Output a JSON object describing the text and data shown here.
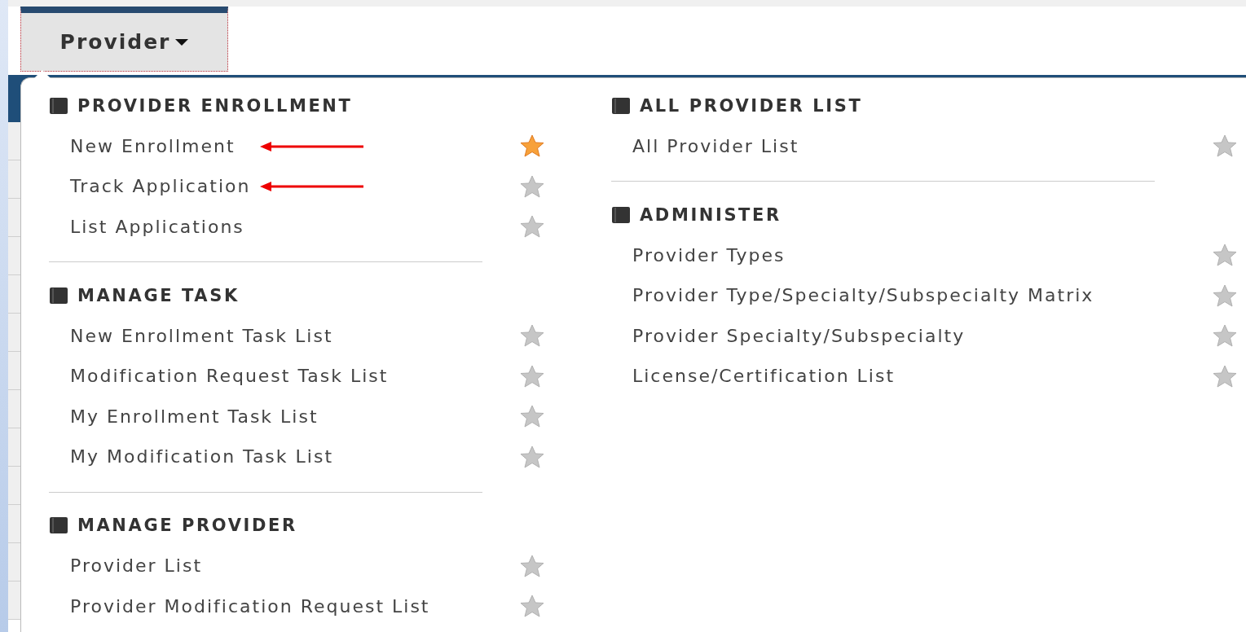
{
  "nav": {
    "tab": {
      "label": "Provider",
      "expanded": true
    }
  },
  "menu": {
    "columns": [
      {
        "sections": [
          {
            "title": "PROVIDER ENROLLMENT",
            "items": [
              {
                "label": "New Enrollment",
                "favorite": true,
                "arrow": true
              },
              {
                "label": "Track Application",
                "favorite": false,
                "arrow": true
              },
              {
                "label": "List Applications",
                "favorite": false,
                "arrow": false
              }
            ]
          },
          {
            "title": "MANAGE TASK",
            "items": [
              {
                "label": "New Enrollment Task List",
                "favorite": false,
                "arrow": false
              },
              {
                "label": "Modification Request Task List",
                "favorite": false,
                "arrow": false
              },
              {
                "label": "My Enrollment Task List",
                "favorite": false,
                "arrow": false
              },
              {
                "label": "My Modification Task List",
                "favorite": false,
                "arrow": false
              }
            ]
          },
          {
            "title": "MANAGE PROVIDER",
            "items": [
              {
                "label": "Provider List",
                "favorite": false,
                "arrow": false
              },
              {
                "label": "Provider Modification Request List",
                "favorite": false,
                "arrow": false
              }
            ]
          }
        ]
      },
      {
        "sections": [
          {
            "title": "ALL PROVIDER LIST",
            "items": [
              {
                "label": "All Provider List",
                "favorite": false,
                "arrow": false
              }
            ]
          },
          {
            "title": "ADMINISTER",
            "items": [
              {
                "label": "Provider Types",
                "favorite": false,
                "arrow": false
              },
              {
                "label": "Provider Type/Specialty/Subspecialty Matrix",
                "favorite": false,
                "arrow": false
              },
              {
                "label": "Provider Specialty/Subspecialty",
                "favorite": false,
                "arrow": false
              },
              {
                "label": "License/Certification List",
                "favorite": false,
                "arrow": false
              }
            ]
          }
        ]
      }
    ]
  }
}
